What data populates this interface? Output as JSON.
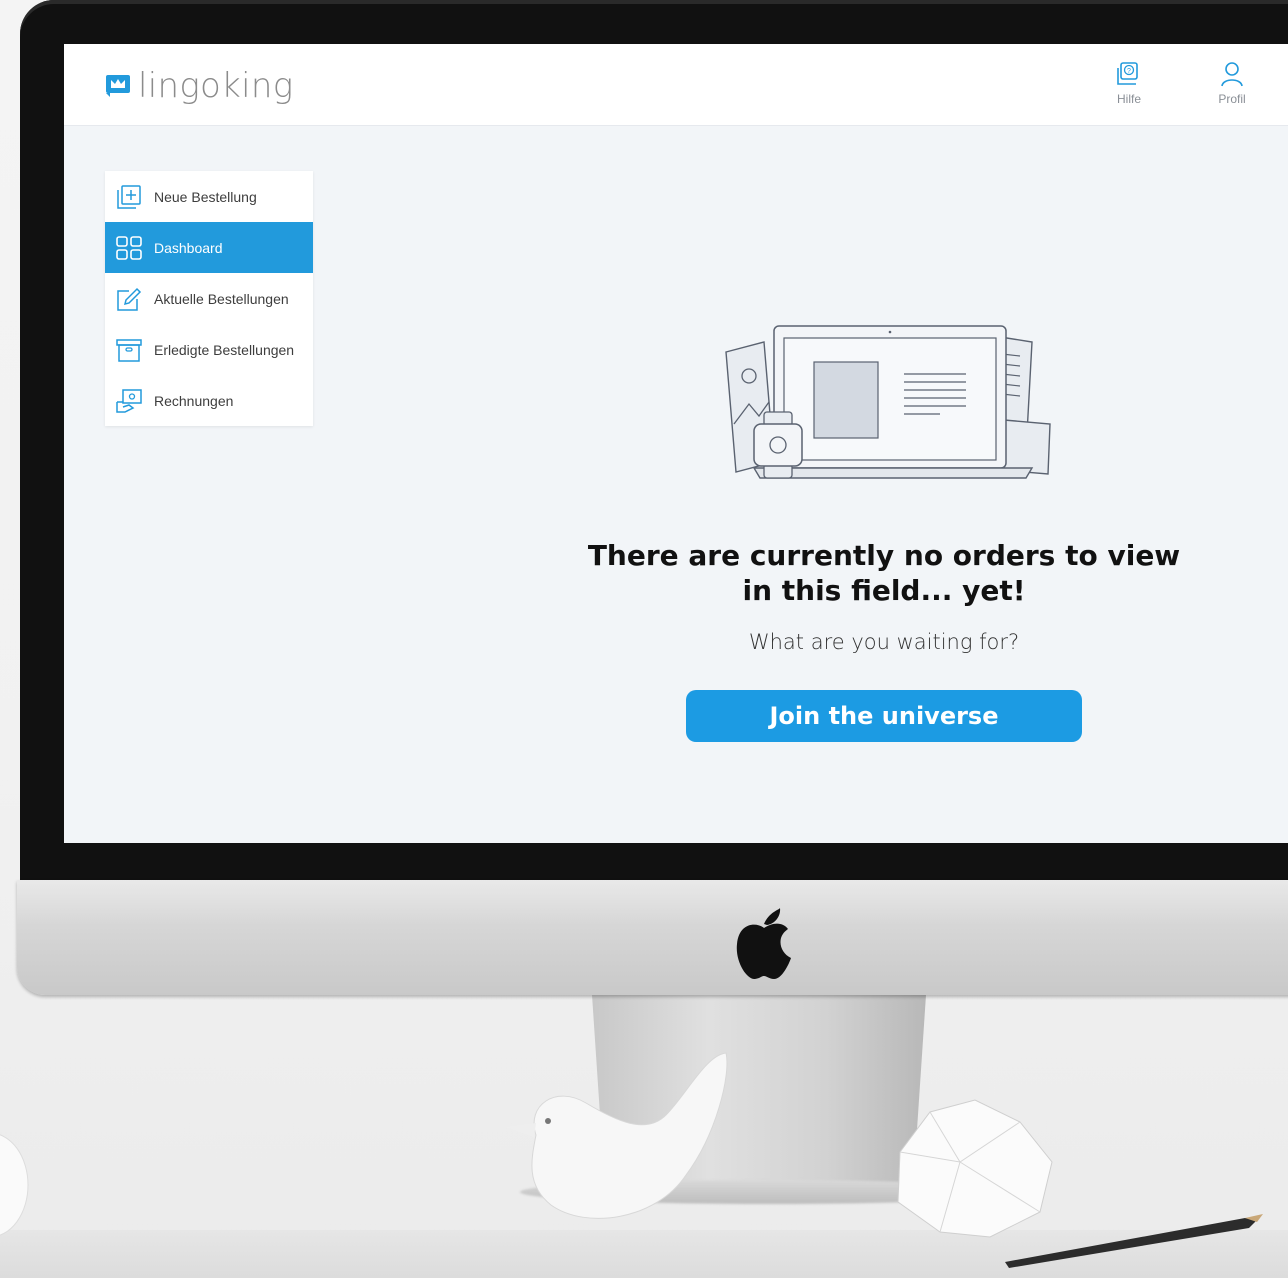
{
  "app": {
    "logo_text": "lingoking"
  },
  "header": {
    "help_label": "Hilfe",
    "profile_label": "Profil"
  },
  "sidebar": {
    "items": [
      {
        "label": "Neue Bestellung",
        "icon": "new-order-icon"
      },
      {
        "label": "Dashboard",
        "icon": "dashboard-grid-icon",
        "active": true
      },
      {
        "label": "Aktuelle Bestellungen",
        "icon": "edit-document-icon"
      },
      {
        "label": "Erledigte Bestellungen",
        "icon": "archive-box-icon"
      },
      {
        "label": "Rechnungen",
        "icon": "invoice-icon"
      }
    ]
  },
  "main": {
    "headline": "There are currently no orders to view in this field... yet!",
    "subline": "What are you waiting for?",
    "cta_label": "Join the universe"
  },
  "colors": {
    "accent": "#229adc",
    "cta": "#1c9be3",
    "screen_bg": "#f2f5f8"
  }
}
